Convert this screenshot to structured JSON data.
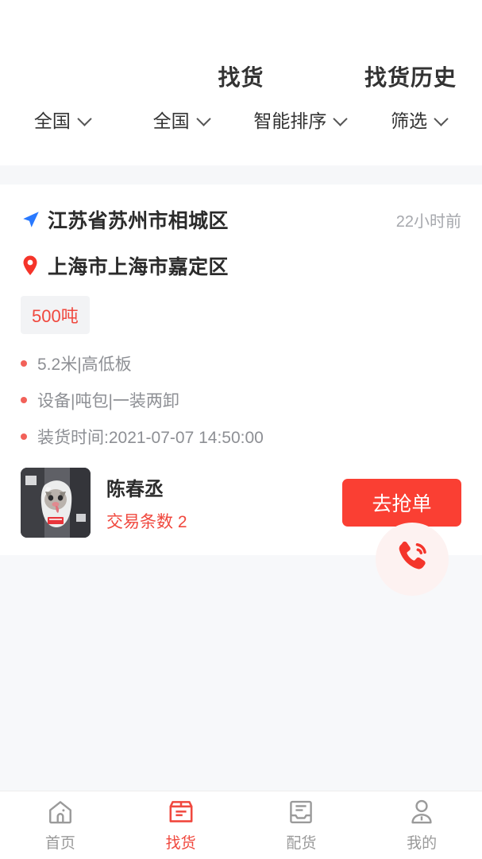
{
  "header": {
    "title": "找货",
    "history_label": "找货历史"
  },
  "filters": [
    {
      "label": "全国",
      "icon": "chevron-down-icon"
    },
    {
      "label": "全国",
      "icon": "chevron-down-icon"
    },
    {
      "label": "智能排序",
      "icon": "chevron-down-icon"
    },
    {
      "label": "筛选",
      "icon": "chevron-down-icon"
    }
  ],
  "card": {
    "origin": "江苏省苏州市相城区",
    "destination": "上海市上海市嘉定区",
    "time_ago": "22小时前",
    "weight_badge": "500吨",
    "details": [
      "5.2米|高低板",
      "设备|吨包|一装两卸",
      "装货时间:2021-07-07 14:50:00"
    ],
    "call_icon": "phone-call-icon",
    "origin_icon": "navigation-arrow-icon",
    "destination_icon": "map-pin-icon",
    "user_name": "陈春丞",
    "user_deals": "交易条数 2",
    "grab_label": "去抢单"
  },
  "tabs": [
    {
      "label": "首页",
      "icon": "home-icon",
      "active": false
    },
    {
      "label": "找货",
      "icon": "package-icon",
      "active": true
    },
    {
      "label": "配货",
      "icon": "inbox-icon",
      "active": false
    },
    {
      "label": "我的",
      "icon": "person-icon",
      "active": false
    }
  ],
  "colors": {
    "accent_red": "#fa3f33",
    "badge_red": "#f0483e",
    "origin_blue": "#2979ff",
    "pin_red": "#f5342a",
    "page_bg": "#f7f8fa"
  }
}
